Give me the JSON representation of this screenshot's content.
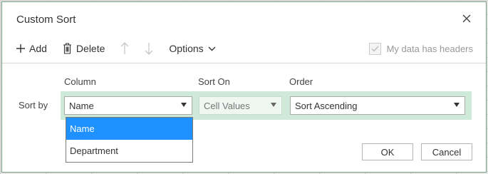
{
  "dialog": {
    "title": "Custom Sort",
    "close_icon": "×"
  },
  "toolbar": {
    "add_label": "Add",
    "delete_label": "Delete",
    "options_label": "Options",
    "headers_label": "My data has headers",
    "headers_checked": true
  },
  "columns": {
    "column_header": "Column",
    "sort_on_header": "Sort On",
    "order_header": "Order"
  },
  "row": {
    "label": "Sort by",
    "column_value": "Name",
    "sort_on_value": "Cell Values",
    "order_value": "Sort Ascending"
  },
  "dropdown": {
    "items": [
      "Name",
      "Department"
    ],
    "selected": "Name"
  },
  "buttons": {
    "ok_label": "OK",
    "cancel_label": "Cancel"
  },
  "colors": {
    "row_highlight": "#cfe9d9",
    "selected_item": "#1e90ff"
  }
}
